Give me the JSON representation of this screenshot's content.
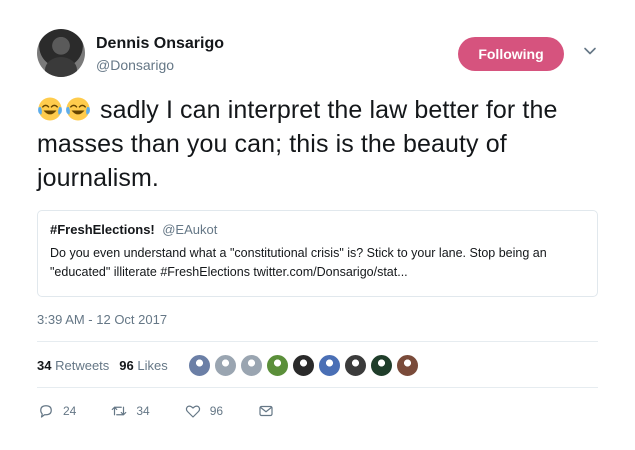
{
  "tweet": {
    "author": {
      "name": "Dennis Onsarigo",
      "handle": "@Donsarigo"
    },
    "follow_button": "Following",
    "text": "sadly I can interpret the law better for the masses than you can; this is the beauty of journalism.",
    "emoji": [
      "face-with-tears-of-joy",
      "face-with-tears-of-joy"
    ],
    "quoted": {
      "name": "#FreshElections!",
      "handle": "@EAukot",
      "text": "Do you even understand what a \"constitutional crisis\" is? Stick to your lane. Stop being an \"educated\" illiterate #FreshElections twitter.com/Donsarigo/stat..."
    },
    "timestamp": "3:39 AM - 12 Oct 2017",
    "stats": {
      "retweets_count": "34",
      "retweets_label": "Retweets",
      "likes_count": "96",
      "likes_label": "Likes"
    },
    "likers": [
      "#6b7fa6",
      "#9aa5b1",
      "#9aa5b1",
      "#5b8f3a",
      "#2a2a2a",
      "#4a6fb5",
      "#3b3b3b",
      "#1f3d2a",
      "#7a4b3a"
    ],
    "actions": {
      "reply_count": "24",
      "retweet_count": "34",
      "like_count": "96"
    }
  },
  "colors": {
    "accent": "#d6537e",
    "muted": "#657786",
    "border": "#e1e8ed"
  }
}
